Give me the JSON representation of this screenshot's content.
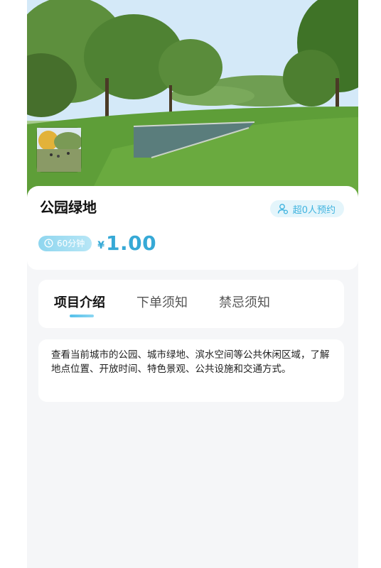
{
  "header": {
    "image_alt": "公园绿地",
    "thumbnails": [
      {
        "icon": "park-photo-thumbnail",
        "selected": true
      },
      {
        "icon": "park-photo-thumbnail",
        "selected": false
      }
    ]
  },
  "service": {
    "title": "公园绿地",
    "booked_label": "超0人预约",
    "duration_label": "60分钟",
    "currency_symbol": "¥",
    "price": "1.00"
  },
  "tabs": [
    {
      "label": "项目介绍",
      "active": true
    },
    {
      "label": "下单须知",
      "active": false
    },
    {
      "label": "禁忌须知",
      "active": false
    }
  ],
  "description": "查看当前城市的公园、城市绿地、滨水空间等公共休闲区域，了解地点位置、开放时间、特色景观、公共设施和交通方式。",
  "colors": {
    "accent": "#36a9d6",
    "badge_bg": "#e4f5fb",
    "page_bg": "#f5f6f8"
  }
}
